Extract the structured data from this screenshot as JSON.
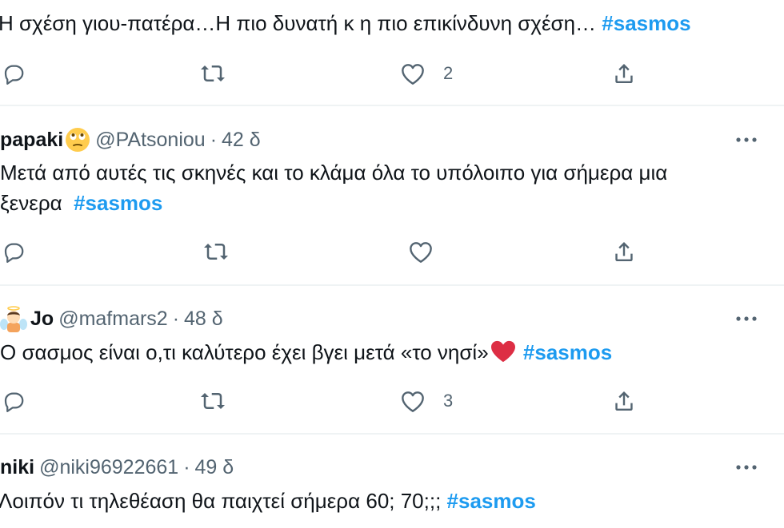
{
  "tweets": [
    {
      "text": "Η σχέση γιου-πατέρα…Η πιο δυνατή κ η πιο επικίνδυνη σχέση… ",
      "hashtag": "#sasmos",
      "actions": {
        "reply": "",
        "retweet": "",
        "like": "2"
      }
    },
    {
      "name": "papaki",
      "handle": "@PAtsoniou",
      "separator": "·",
      "time": "42 δ",
      "text_line1": "Μετά από αυτές τις σκηνές και το κλάμα όλα το υπόλοιπο για σήμερα μια",
      "text_line2": "ξενερα  ",
      "hashtag": "#sasmos",
      "actions": {
        "reply": "",
        "retweet": "",
        "like": ""
      }
    },
    {
      "name": "Jo",
      "handle": "@mafmars2",
      "separator": "·",
      "time": "48 δ",
      "text": "Ο σασμος είναι ο,τι καλύτερο έχει βγει μετά «το νησί»",
      "hashtag": "#sasmos",
      "actions": {
        "reply": "",
        "retweet": "",
        "like": "3"
      }
    },
    {
      "name": "niki",
      "handle": "@niki96922661",
      "separator": "·",
      "time": "49 δ",
      "text": "Λοιπόν τι τηλεθέαση θα παιχτεί σήμερα 60; 70;;; ",
      "hashtag": "#sasmos"
    }
  ],
  "icons": {
    "reply": "reply-icon",
    "retweet": "retweet-icon",
    "like": "heart-icon",
    "share": "share-icon",
    "more": "more-icon"
  },
  "colors": {
    "hashtag": "#1d9bf0",
    "secondary_text": "#536471",
    "icon": "#536471",
    "divider": "#eff3f4",
    "heart_emoji": "#dd2e44"
  }
}
